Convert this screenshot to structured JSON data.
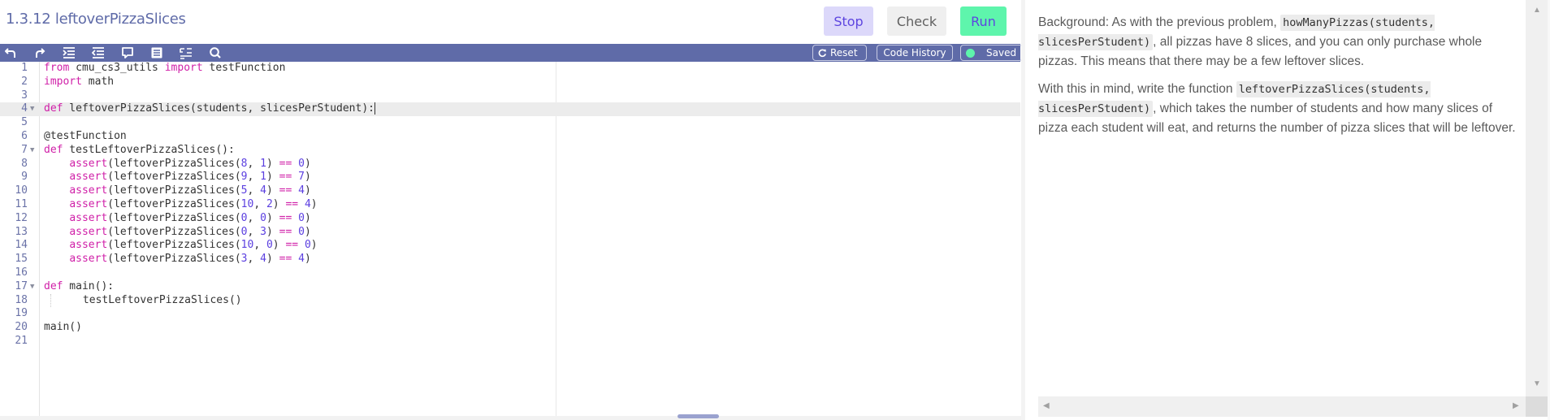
{
  "header": {
    "title": "1.3.12 leftoverPizzaSlices",
    "buttons": {
      "stop": "Stop",
      "check": "Check",
      "run": "Run"
    }
  },
  "toolbar": {
    "icons": [
      "undo-icon",
      "redo-icon",
      "indent-icon",
      "outdent-icon",
      "comment-icon",
      "format-icon",
      "wrap-icon",
      "search-icon"
    ],
    "reset_label": "Reset",
    "history_label": "Code History",
    "saved_label": "Saved",
    "saved_color": "#5ef5ac"
  },
  "editor": {
    "active_line": 4,
    "lines": [
      {
        "n": "1",
        "fold": false,
        "tokens": [
          [
            "kw",
            "from"
          ],
          [
            "t",
            " cmu_cs3_utils "
          ],
          [
            "kw",
            "import"
          ],
          [
            "t",
            " testFunction"
          ]
        ]
      },
      {
        "n": "2",
        "fold": false,
        "tokens": [
          [
            "kw",
            "import"
          ],
          [
            "t",
            " math"
          ]
        ]
      },
      {
        "n": "3",
        "fold": false,
        "tokens": []
      },
      {
        "n": "4",
        "fold": true,
        "tokens": [
          [
            "kw",
            "def"
          ],
          [
            "t",
            " leftoverPizzaSlices(students, slicesPerStudent):"
          ]
        ]
      },
      {
        "n": "5",
        "fold": false,
        "tokens": []
      },
      {
        "n": "6",
        "fold": false,
        "tokens": [
          [
            "t",
            "@testFunction"
          ]
        ]
      },
      {
        "n": "7",
        "fold": true,
        "tokens": [
          [
            "kw",
            "def"
          ],
          [
            "t",
            " testLeftoverPizzaSlices():"
          ]
        ]
      },
      {
        "n": "8",
        "fold": false,
        "tokens": [
          [
            "t",
            "    "
          ],
          [
            "kw",
            "assert"
          ],
          [
            "t",
            "(leftoverPizzaSlices("
          ],
          [
            "num",
            "8"
          ],
          [
            "t",
            ", "
          ],
          [
            "num",
            "1"
          ],
          [
            "t",
            ") "
          ],
          [
            "op",
            "=="
          ],
          [
            "t",
            " "
          ],
          [
            "num",
            "0"
          ],
          [
            "t",
            ")"
          ]
        ]
      },
      {
        "n": "9",
        "fold": false,
        "tokens": [
          [
            "t",
            "    "
          ],
          [
            "kw",
            "assert"
          ],
          [
            "t",
            "(leftoverPizzaSlices("
          ],
          [
            "num",
            "9"
          ],
          [
            "t",
            ", "
          ],
          [
            "num",
            "1"
          ],
          [
            "t",
            ") "
          ],
          [
            "op",
            "=="
          ],
          [
            "t",
            " "
          ],
          [
            "num",
            "7"
          ],
          [
            "t",
            ")"
          ]
        ]
      },
      {
        "n": "10",
        "fold": false,
        "tokens": [
          [
            "t",
            "    "
          ],
          [
            "kw",
            "assert"
          ],
          [
            "t",
            "(leftoverPizzaSlices("
          ],
          [
            "num",
            "5"
          ],
          [
            "t",
            ", "
          ],
          [
            "num",
            "4"
          ],
          [
            "t",
            ") "
          ],
          [
            "op",
            "=="
          ],
          [
            "t",
            " "
          ],
          [
            "num",
            "4"
          ],
          [
            "t",
            ")"
          ]
        ]
      },
      {
        "n": "11",
        "fold": false,
        "tokens": [
          [
            "t",
            "    "
          ],
          [
            "kw",
            "assert"
          ],
          [
            "t",
            "(leftoverPizzaSlices("
          ],
          [
            "num",
            "10"
          ],
          [
            "t",
            ", "
          ],
          [
            "num",
            "2"
          ],
          [
            "t",
            ") "
          ],
          [
            "op",
            "=="
          ],
          [
            "t",
            " "
          ],
          [
            "num",
            "4"
          ],
          [
            "t",
            ")"
          ]
        ]
      },
      {
        "n": "12",
        "fold": false,
        "tokens": [
          [
            "t",
            "    "
          ],
          [
            "kw",
            "assert"
          ],
          [
            "t",
            "(leftoverPizzaSlices("
          ],
          [
            "num",
            "0"
          ],
          [
            "t",
            ", "
          ],
          [
            "num",
            "0"
          ],
          [
            "t",
            ") "
          ],
          [
            "op",
            "=="
          ],
          [
            "t",
            " "
          ],
          [
            "num",
            "0"
          ],
          [
            "t",
            ")"
          ]
        ]
      },
      {
        "n": "13",
        "fold": false,
        "tokens": [
          [
            "t",
            "    "
          ],
          [
            "kw",
            "assert"
          ],
          [
            "t",
            "(leftoverPizzaSlices("
          ],
          [
            "num",
            "0"
          ],
          [
            "t",
            ", "
          ],
          [
            "num",
            "3"
          ],
          [
            "t",
            ") "
          ],
          [
            "op",
            "=="
          ],
          [
            "t",
            " "
          ],
          [
            "num",
            "0"
          ],
          [
            "t",
            ")"
          ]
        ]
      },
      {
        "n": "14",
        "fold": false,
        "tokens": [
          [
            "t",
            "    "
          ],
          [
            "kw",
            "assert"
          ],
          [
            "t",
            "(leftoverPizzaSlices("
          ],
          [
            "num",
            "10"
          ],
          [
            "t",
            ", "
          ],
          [
            "num",
            "0"
          ],
          [
            "t",
            ") "
          ],
          [
            "op",
            "=="
          ],
          [
            "t",
            " "
          ],
          [
            "num",
            "0"
          ],
          [
            "t",
            ")"
          ]
        ]
      },
      {
        "n": "15",
        "fold": false,
        "tokens": [
          [
            "t",
            "    "
          ],
          [
            "kw",
            "assert"
          ],
          [
            "t",
            "(leftoverPizzaSlices("
          ],
          [
            "num",
            "3"
          ],
          [
            "t",
            ", "
          ],
          [
            "num",
            "4"
          ],
          [
            "t",
            ") "
          ],
          [
            "op",
            "=="
          ],
          [
            "t",
            " "
          ],
          [
            "num",
            "4"
          ],
          [
            "t",
            ")"
          ]
        ]
      },
      {
        "n": "16",
        "fold": false,
        "tokens": []
      },
      {
        "n": "17",
        "fold": true,
        "tokens": [
          [
            "kw",
            "def"
          ],
          [
            "t",
            " main():"
          ]
        ]
      },
      {
        "n": "18",
        "fold": false,
        "tokens": [
          [
            "guide",
            ""
          ],
          [
            "t",
            "     testLeftoverPizzaSlices()"
          ]
        ]
      },
      {
        "n": "19",
        "fold": false,
        "tokens": []
      },
      {
        "n": "20",
        "fold": false,
        "tokens": [
          [
            "t",
            "main()"
          ]
        ]
      },
      {
        "n": "21",
        "fold": false,
        "tokens": []
      }
    ]
  },
  "description": {
    "paragraphs": [
      [
        {
          "type": "text",
          "value": "Background: As with the previous problem, "
        },
        {
          "type": "code",
          "value": "howManyPizzas(students, slicesPerStudent)"
        },
        {
          "type": "text",
          "value": ", all pizzas have 8 slices, and you can only purchase whole pizzas. This means that there may be a few leftover slices."
        }
      ],
      [
        {
          "type": "text",
          "value": "With this in mind, write the function "
        },
        {
          "type": "code",
          "value": "leftoverPizzaSlices(students, slicesPerStudent)"
        },
        {
          "type": "text",
          "value": ", which takes the number of students and how many slices of pizza each student will eat, and returns the number of pizza slices that will be leftover."
        }
      ]
    ]
  },
  "colors": {
    "accent": "#5f6ba8",
    "stop_bg": "#dcd8fa",
    "run_bg": "#5ef5ac",
    "keyword": "#d020a8",
    "number": "#5b3fe0"
  }
}
